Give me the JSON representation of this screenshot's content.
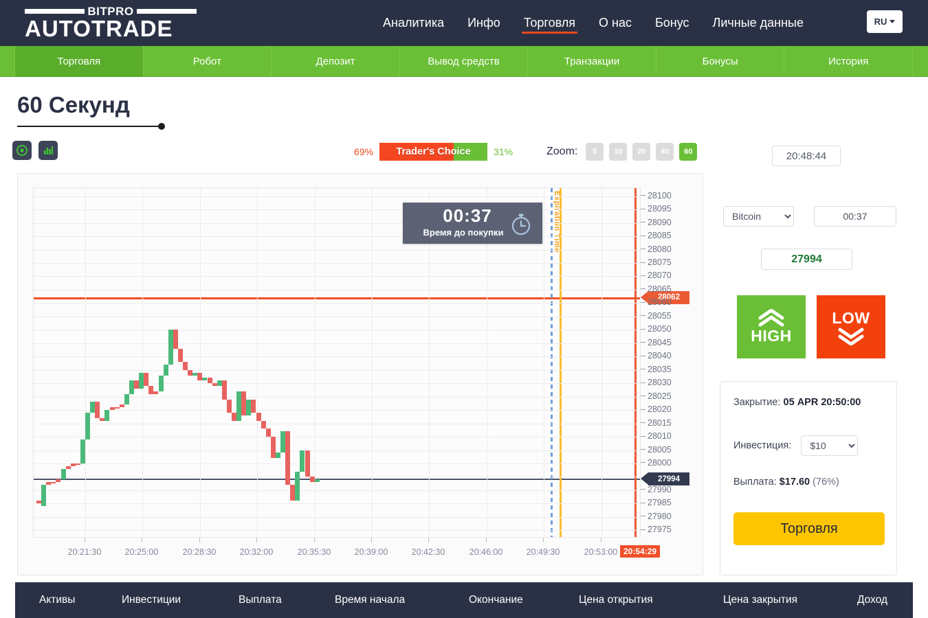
{
  "brand": {
    "top": "BITPRO",
    "main": "AUTOTRADE"
  },
  "header": {
    "nav": [
      {
        "label": "Аналитика",
        "active": false
      },
      {
        "label": "Инфо",
        "active": false
      },
      {
        "label": "Торговля",
        "active": true
      },
      {
        "label": "О нас",
        "active": false
      },
      {
        "label": "Бонус",
        "active": false
      },
      {
        "label": "Личные данные",
        "active": false
      }
    ],
    "language": "RU"
  },
  "subnav": [
    {
      "label": "Торговля",
      "active": true
    },
    {
      "label": "Робот",
      "active": false
    },
    {
      "label": "Депозит",
      "active": false
    },
    {
      "label": "Вывод средств",
      "active": false
    },
    {
      "label": "Транзакции",
      "active": false
    },
    {
      "label": "Бонусы",
      "active": false
    },
    {
      "label": "История",
      "active": false
    }
  ],
  "page": {
    "title": "60 Секунд"
  },
  "toolbar": {
    "icons": [
      {
        "name": "radio-target-icon"
      },
      {
        "name": "bar-chart-icon"
      }
    ],
    "traders_choice": {
      "label": "Trader's Choice",
      "left_pct": "69%",
      "right_pct": "31%",
      "left_value": 69,
      "right_value": 31,
      "left_color": "#f44721",
      "right_color": "#6abf36"
    },
    "zoom_label": "Zoom:",
    "zoom_options": [
      {
        "label": "5",
        "active": false
      },
      {
        "label": "10",
        "active": false
      },
      {
        "label": "20",
        "active": false
      },
      {
        "label": "40",
        "active": false
      },
      {
        "label": "60",
        "active": true
      }
    ],
    "clock": "20:48:44"
  },
  "trade_panel": {
    "asset_selected": "Bitcoin",
    "asset_options": [
      "Bitcoin"
    ],
    "duration": "00:37",
    "current_price": "27994",
    "high_label": "HIGH",
    "low_label": "LOW",
    "close_label": "Закрытие:",
    "close_value": "05 APR 20:50:00",
    "invest_label": "Инвестиция:",
    "invest_selected": "$10",
    "invest_options": [
      "$10"
    ],
    "payout_label": "Выплата:",
    "payout_value": "$17.60",
    "payout_pct": "(76%)",
    "trade_button": "Торговля"
  },
  "countdown": {
    "time": "00:37",
    "caption": "Время до покупки",
    "icon": "stopwatch-icon"
  },
  "chart_data": {
    "type": "line",
    "title": "60 Секунд — Bitcoin",
    "xlabel": "",
    "ylabel": "",
    "grid": true,
    "legend": "none",
    "expiration_label": "Expiration Time",
    "current_price_marker": "27994",
    "strike_price_marker": "28062",
    "now_time_marker": "20:54:29",
    "ylim": [
      27972,
      28103
    ],
    "yticks": [
      28100,
      28095,
      28090,
      28085,
      28080,
      28075,
      28070,
      28065,
      28060,
      28055,
      28050,
      28045,
      28040,
      28035,
      28030,
      28025,
      28020,
      28015,
      28010,
      28005,
      28000,
      27990,
      27985,
      27980,
      27975
    ],
    "xticks": [
      "20:21:30",
      "20:25:00",
      "20:28:30",
      "20:32:00",
      "20:35:30",
      "20:39:00",
      "20:42:30",
      "20:46:00",
      "20:49:30",
      "20:53:00"
    ],
    "candles": [
      {
        "t": "20:20:00",
        "o": 27985,
        "c": 27986,
        "dir": "dn"
      },
      {
        "t": "20:20:30",
        "o": 27984,
        "c": 27992,
        "dir": "up"
      },
      {
        "t": "20:21:00",
        "o": 27992,
        "c": 27993,
        "dir": "dn"
      },
      {
        "t": "20:21:30",
        "o": 27993,
        "c": 27993,
        "dir": "dn"
      },
      {
        "t": "20:22:00",
        "o": 27993,
        "c": 27994,
        "dir": "dn"
      },
      {
        "t": "20:22:30",
        "o": 27994,
        "c": 27998,
        "dir": "up"
      },
      {
        "t": "20:23:00",
        "o": 27998,
        "c": 27999,
        "dir": "dn"
      },
      {
        "t": "20:23:30",
        "o": 27999,
        "c": 28000,
        "dir": "dn"
      },
      {
        "t": "20:24:00",
        "o": 28000,
        "c": 28000,
        "dir": "dn"
      },
      {
        "t": "20:24:30",
        "o": 28000,
        "c": 28009,
        "dir": "up"
      },
      {
        "t": "20:25:00",
        "o": 28009,
        "c": 28019,
        "dir": "up"
      },
      {
        "t": "20:25:30",
        "o": 28019,
        "c": 28023,
        "dir": "up"
      },
      {
        "t": "20:26:00",
        "o": 28023,
        "c": 28017,
        "dir": "dn"
      },
      {
        "t": "20:26:30",
        "o": 28017,
        "c": 28016,
        "dir": "dn"
      },
      {
        "t": "20:27:00",
        "o": 28016,
        "c": 28020,
        "dir": "up"
      },
      {
        "t": "20:27:30",
        "o": 28020,
        "c": 28021,
        "dir": "dn"
      },
      {
        "t": "20:28:00",
        "o": 28021,
        "c": 28021,
        "dir": "dn"
      },
      {
        "t": "20:28:30",
        "o": 28021,
        "c": 28022,
        "dir": "dn"
      },
      {
        "t": "20:29:00",
        "o": 28022,
        "c": 28026,
        "dir": "up"
      },
      {
        "t": "20:29:30",
        "o": 28026,
        "c": 28031,
        "dir": "up"
      },
      {
        "t": "20:30:00",
        "o": 28031,
        "c": 28028,
        "dir": "dn"
      },
      {
        "t": "20:30:30",
        "o": 28028,
        "c": 28034,
        "dir": "up"
      },
      {
        "t": "20:31:00",
        "o": 28034,
        "c": 28029,
        "dir": "dn"
      },
      {
        "t": "20:31:30",
        "o": 28029,
        "c": 28026,
        "dir": "dn"
      },
      {
        "t": "20:32:00",
        "o": 28026,
        "c": 28027,
        "dir": "dn"
      },
      {
        "t": "20:32:30",
        "o": 28027,
        "c": 28033,
        "dir": "up"
      },
      {
        "t": "20:33:00",
        "o": 28033,
        "c": 28037,
        "dir": "up"
      },
      {
        "t": "20:33:30",
        "o": 28037,
        "c": 28050,
        "dir": "up"
      },
      {
        "t": "20:34:00",
        "o": 28050,
        "c": 28043,
        "dir": "dn"
      },
      {
        "t": "20:34:30",
        "o": 28043,
        "c": 28038,
        "dir": "dn"
      },
      {
        "t": "20:35:00",
        "o": 28038,
        "c": 28035,
        "dir": "dn"
      },
      {
        "t": "20:35:30",
        "o": 28035,
        "c": 28033,
        "dir": "dn"
      },
      {
        "t": "20:36:00",
        "o": 28033,
        "c": 28034,
        "dir": "up"
      },
      {
        "t": "20:36:30",
        "o": 28034,
        "c": 28031,
        "dir": "dn"
      },
      {
        "t": "20:37:00",
        "o": 28031,
        "c": 28032,
        "dir": "up"
      },
      {
        "t": "20:37:30",
        "o": 28032,
        "c": 28030,
        "dir": "dn"
      },
      {
        "t": "20:38:00",
        "o": 28030,
        "c": 28029,
        "dir": "dn"
      },
      {
        "t": "20:38:30",
        "o": 28029,
        "c": 28031,
        "dir": "up"
      },
      {
        "t": "20:39:00",
        "o": 28031,
        "c": 28024,
        "dir": "dn"
      },
      {
        "t": "20:39:30",
        "o": 28024,
        "c": 28019,
        "dir": "dn"
      },
      {
        "t": "20:40:00",
        "o": 28019,
        "c": 28016,
        "dir": "dn"
      },
      {
        "t": "20:40:30",
        "o": 28016,
        "c": 28027,
        "dir": "up"
      },
      {
        "t": "20:41:00",
        "o": 28027,
        "c": 28018,
        "dir": "dn"
      },
      {
        "t": "20:41:30",
        "o": 28018,
        "c": 28024,
        "dir": "up"
      },
      {
        "t": "20:42:00",
        "o": 28024,
        "c": 28019,
        "dir": "dn"
      },
      {
        "t": "20:42:30",
        "o": 28019,
        "c": 28016,
        "dir": "dn"
      },
      {
        "t": "20:43:00",
        "o": 28016,
        "c": 28013,
        "dir": "dn"
      },
      {
        "t": "20:43:30",
        "o": 28013,
        "c": 28010,
        "dir": "dn"
      },
      {
        "t": "20:44:00",
        "o": 28010,
        "c": 28002,
        "dir": "dn"
      },
      {
        "t": "20:44:30",
        "o": 28002,
        "c": 28004,
        "dir": "up"
      },
      {
        "t": "20:45:00",
        "o": 28004,
        "c": 28012,
        "dir": "up"
      },
      {
        "t": "20:45:30",
        "o": 28012,
        "c": 27992,
        "dir": "dn"
      },
      {
        "t": "20:46:00",
        "o": 27992,
        "c": 27986,
        "dir": "dn"
      },
      {
        "t": "20:46:30",
        "o": 27986,
        "c": 27997,
        "dir": "up"
      },
      {
        "t": "20:47:00",
        "o": 27997,
        "c": 28005,
        "dir": "up"
      },
      {
        "t": "20:47:30",
        "o": 28005,
        "c": 27995,
        "dir": "dn"
      },
      {
        "t": "20:48:00",
        "o": 27995,
        "c": 27993,
        "dir": "dn"
      },
      {
        "t": "20:48:30",
        "o": 27993,
        "c": 27994,
        "dir": "up"
      }
    ]
  },
  "table": {
    "columns": [
      "Активы",
      "Инвестиции",
      "Выплата",
      "Время начала",
      "Окончание",
      "Цена открытия",
      "Цена закрытия",
      "Доход"
    ]
  }
}
